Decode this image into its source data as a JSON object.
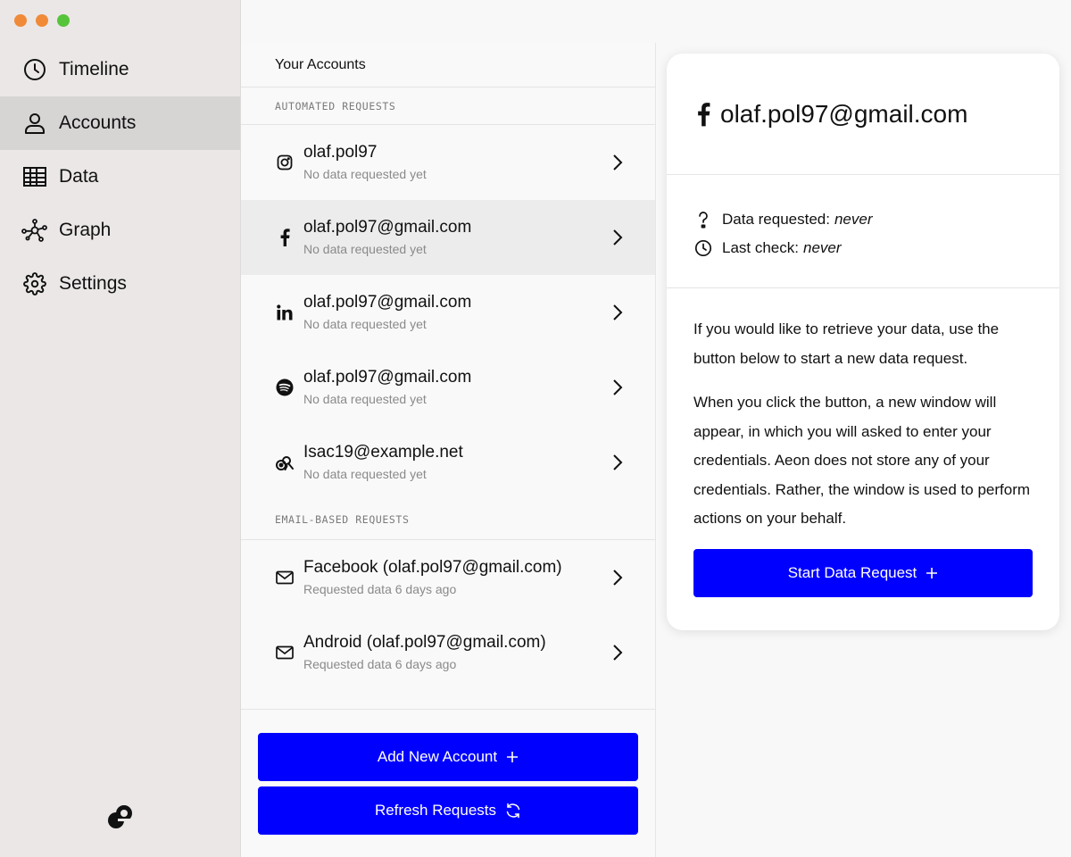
{
  "window": {
    "traffic_lights": [
      "#f08a38",
      "#f08a38",
      "#55c43a"
    ]
  },
  "sidebar": {
    "items": [
      {
        "label": "Timeline",
        "icon": "clock-icon",
        "active": false
      },
      {
        "label": "Accounts",
        "icon": "user-icon",
        "active": true
      },
      {
        "label": "Data",
        "icon": "table-icon",
        "active": false
      },
      {
        "label": "Graph",
        "icon": "graph-icon",
        "active": false
      },
      {
        "label": "Settings",
        "icon": "gear-icon",
        "active": false
      }
    ],
    "logo": "ae-logo"
  },
  "accounts": {
    "title": "Your Accounts",
    "automated_label": "AUTOMATED REQUESTS",
    "automated": [
      {
        "name": "olaf.pol97",
        "status": "No data requested yet",
        "icon": "instagram-icon"
      },
      {
        "name": "olaf.pol97@gmail.com",
        "status": "No data requested yet",
        "icon": "facebook-icon",
        "active": true
      },
      {
        "name": "olaf.pol97@gmail.com",
        "status": "No data requested yet",
        "icon": "linkedin-icon"
      },
      {
        "name": "olaf.pol97@gmail.com",
        "status": "No data requested yet",
        "icon": "spotify-icon"
      },
      {
        "name": "Isac19@example.net",
        "status": "No data requested yet",
        "icon": "open-data-rights-icon"
      }
    ],
    "email_label": "EMAIL-BASED REQUESTS",
    "email": [
      {
        "name": "Facebook (olaf.pol97@gmail.com)",
        "status": "Requested data 6 days ago",
        "icon": "mail-icon"
      },
      {
        "name": "Android (olaf.pol97@gmail.com)",
        "status": "Requested data 6 days ago",
        "icon": "mail-icon"
      }
    ],
    "add_button": "Add New Account",
    "refresh_button": "Refresh Requests"
  },
  "detail": {
    "account": "olaf.pol97@gmail.com",
    "icon": "facebook-icon",
    "data_requested_label": "Data requested: ",
    "data_requested_value": "never",
    "last_check_label": "Last check: ",
    "last_check_value": "never",
    "paragraph1": "If you would like to retrieve your data, use the button below to start a new data request.",
    "paragraph2": "When you click the button, a new window will appear, in which you will asked to enter your credentials. Aeon does not store any of your credentials. Rather, the window is used to perform actions on your behalf.",
    "start_button": "Start Data Request"
  },
  "colors": {
    "accent": "#0000ff",
    "sidebar_bg": "#ebe7e7",
    "sidebar_active": "#d7d4d4"
  }
}
